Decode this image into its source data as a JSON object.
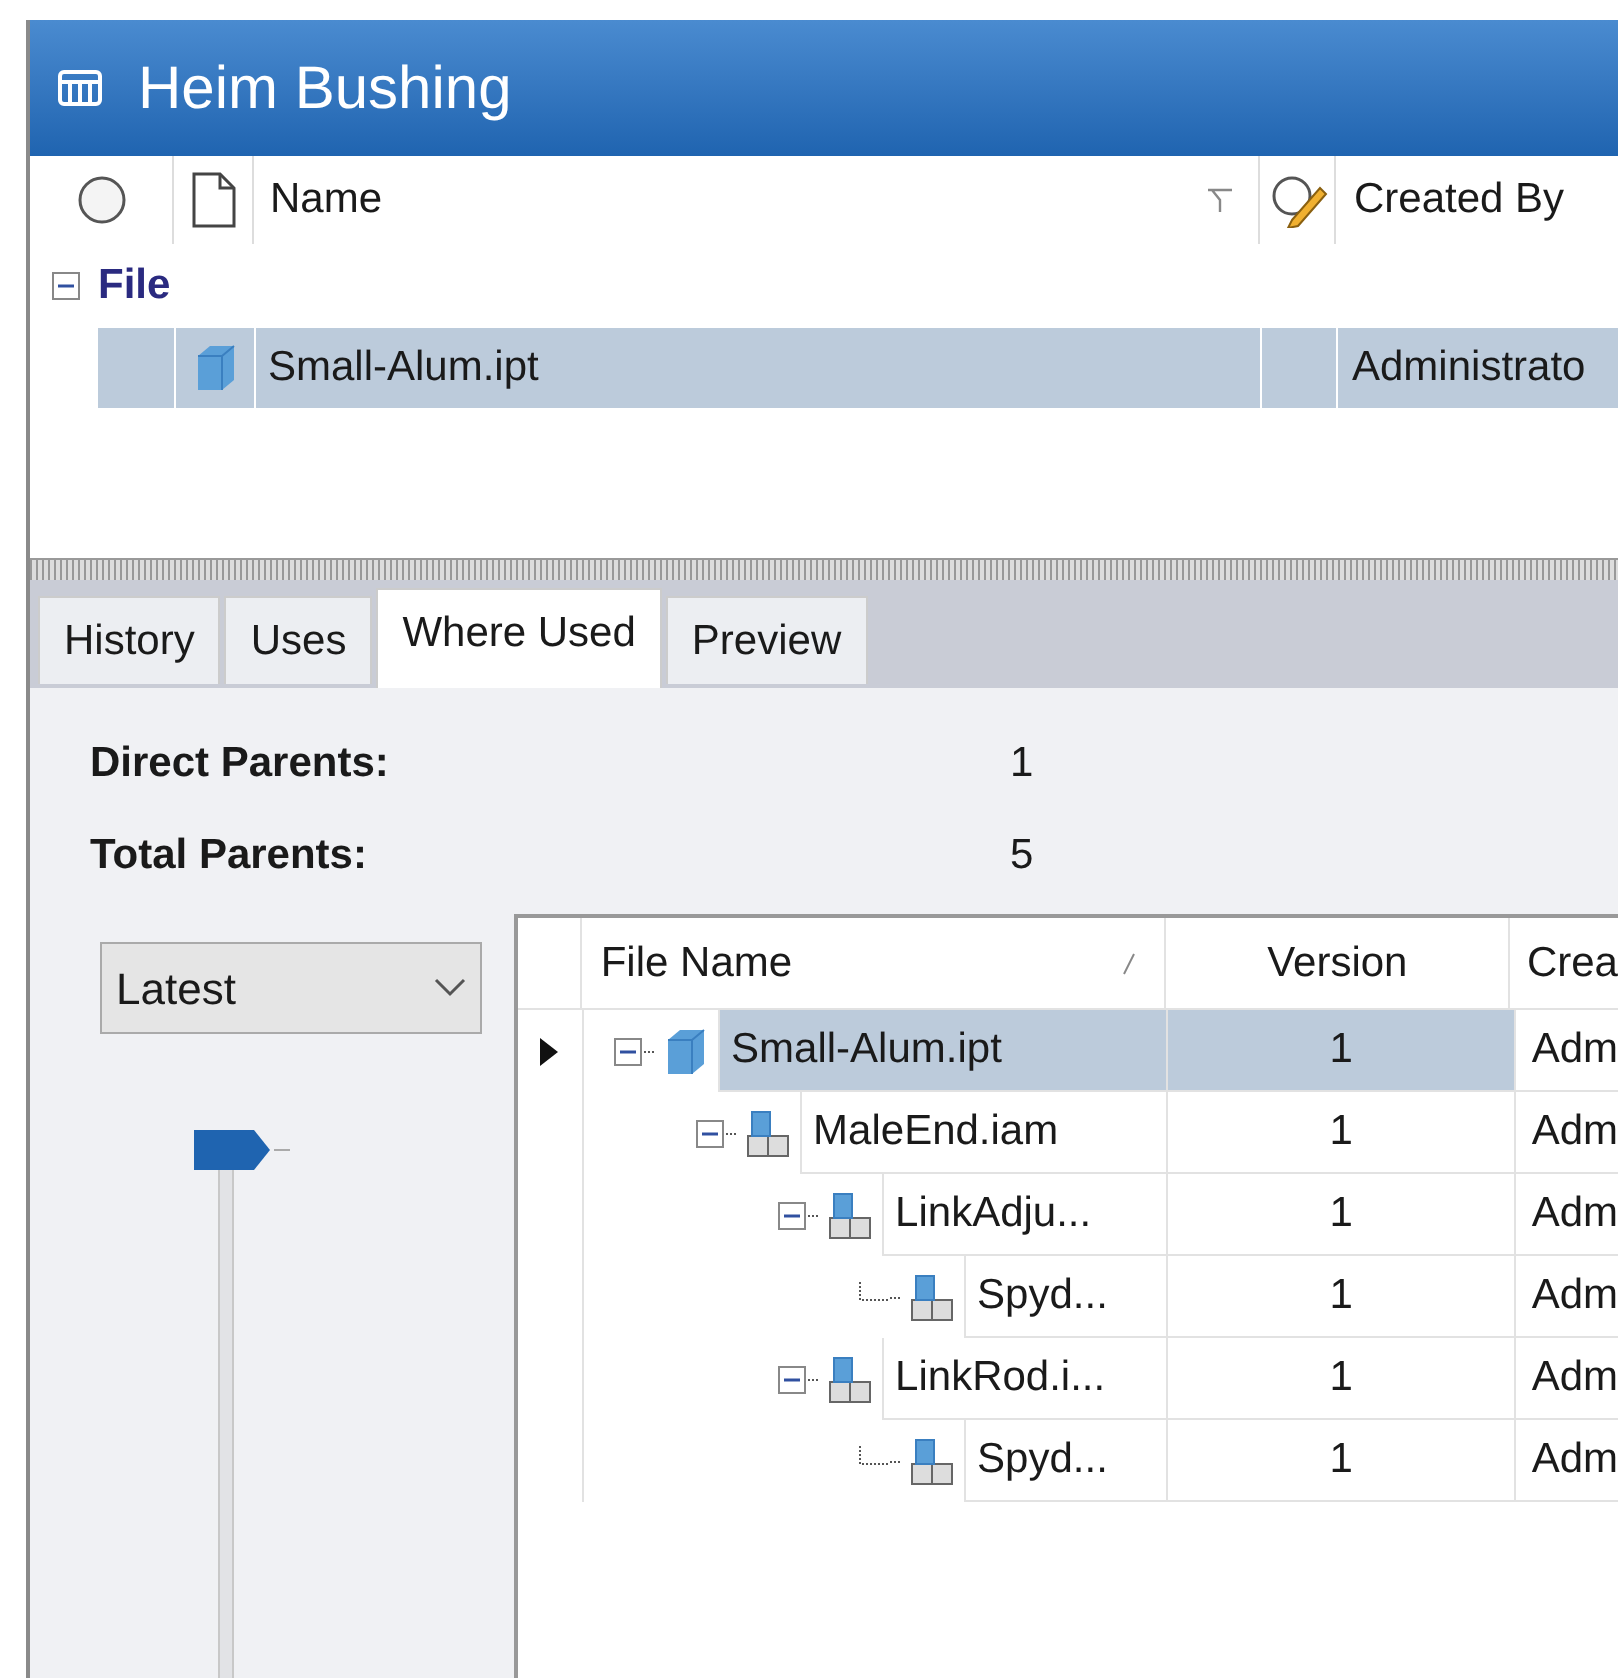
{
  "window": {
    "title": "Heim Bushing"
  },
  "file_list": {
    "columns": [
      "Name",
      "Created By"
    ],
    "groups": [
      {
        "label": "File",
        "expanded": true,
        "rows": [
          {
            "name": "Small-Alum.ipt",
            "created_by": "Administrato",
            "selected": true
          }
        ]
      }
    ]
  },
  "tabs": [
    {
      "label": "History",
      "selected": false
    },
    {
      "label": "Uses",
      "selected": false
    },
    {
      "label": "Where Used",
      "selected": true
    },
    {
      "label": "Preview",
      "selected": false
    }
  ],
  "summary": [
    {
      "label": "Direct Parents:",
      "value": "1"
    },
    {
      "label": "Total Parents:",
      "value": "5"
    }
  ],
  "version_dropdown": {
    "value": "Latest"
  },
  "where_used": {
    "columns": [
      "File Name",
      "Version",
      "Crea"
    ],
    "rows": [
      {
        "kind": "part",
        "name": "Small-Alum.ipt",
        "version": "1",
        "created_by": "Adm",
        "selected": true,
        "expanded": true,
        "children": [
          {
            "kind": "assembly",
            "name": "MaleEnd.iam",
            "version": "1",
            "created_by": "Adm",
            "selected": false,
            "expanded": true,
            "children": [
              {
                "kind": "assembly",
                "name": "LinkAdju...",
                "version": "1",
                "created_by": "Adm",
                "selected": false,
                "expanded": true,
                "children": [
                  {
                    "kind": "assembly",
                    "name": "Spyd...",
                    "version": "1",
                    "created_by": "Adm",
                    "selected": false
                  }
                ]
              },
              {
                "kind": "assembly",
                "name": "LinkRod.i...",
                "version": "1",
                "created_by": "Adm",
                "selected": false,
                "expanded": true,
                "children": [
                  {
                    "kind": "assembly",
                    "name": "Spyd...",
                    "version": "1",
                    "created_by": "Adm",
                    "selected": false
                  }
                ]
              }
            ]
          }
        ]
      }
    ]
  }
}
